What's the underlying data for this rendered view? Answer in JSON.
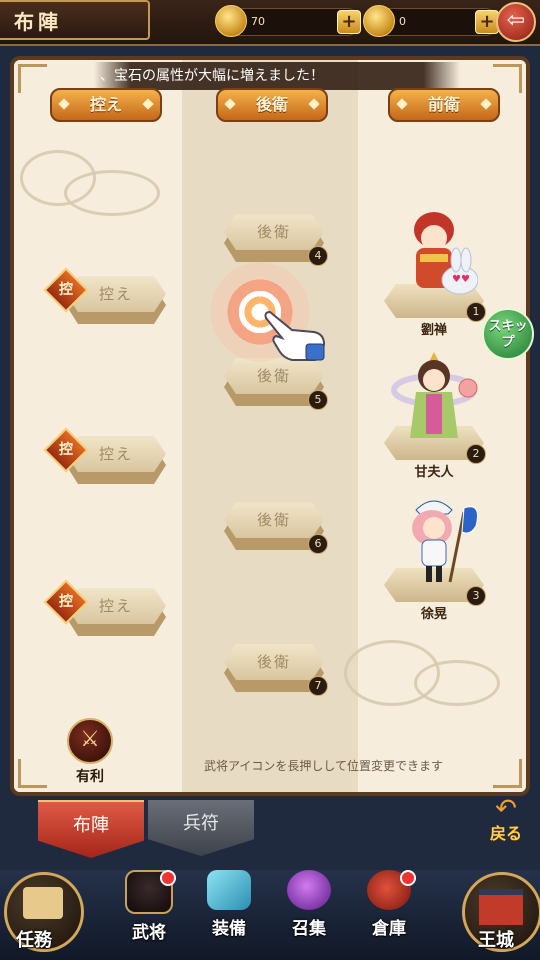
{
  "header": {
    "title": "布陣",
    "gold": "70",
    "coupon": "0",
    "plus_label": "+",
    "back_glyph": "⇦"
  },
  "banner": {
    "text": "、宝石の属性が大幅に増えました！"
  },
  "columns": {
    "reserve": "控え",
    "rear": "後衛",
    "front": "前衛"
  },
  "reserve_slots": [
    {
      "tag": "控",
      "label": "控え"
    },
    {
      "tag": "控",
      "label": "控え"
    },
    {
      "tag": "控",
      "label": "控え"
    }
  ],
  "rear_slots": [
    {
      "label": "後衛",
      "num": "4"
    },
    {
      "label": "後衛",
      "num": "5"
    },
    {
      "label": "後衛",
      "num": "6"
    },
    {
      "label": "後衛",
      "num": "7"
    }
  ],
  "heroes": [
    {
      "name": "劉禅",
      "num": "1"
    },
    {
      "name": "甘夫人",
      "num": "2"
    },
    {
      "name": "徐晃",
      "num": "3"
    }
  ],
  "skip_label": "スキップ",
  "hint": "武将アイコンを長押しして位置変更できます",
  "advantage_label": "有利",
  "tabs": {
    "formation": "布陣",
    "troops": "兵符"
  },
  "return_label": "戻る",
  "nav": {
    "mission": "任務",
    "generals": "武将",
    "equip": "装備",
    "summon": "召集",
    "storage": "倉庫",
    "castle": "王城"
  },
  "colors": {
    "accent_orange": "#e07a25",
    "tab_red": "#c23a2a",
    "skip_green": "#2e9b48",
    "board_bg": "#efe4cf"
  }
}
